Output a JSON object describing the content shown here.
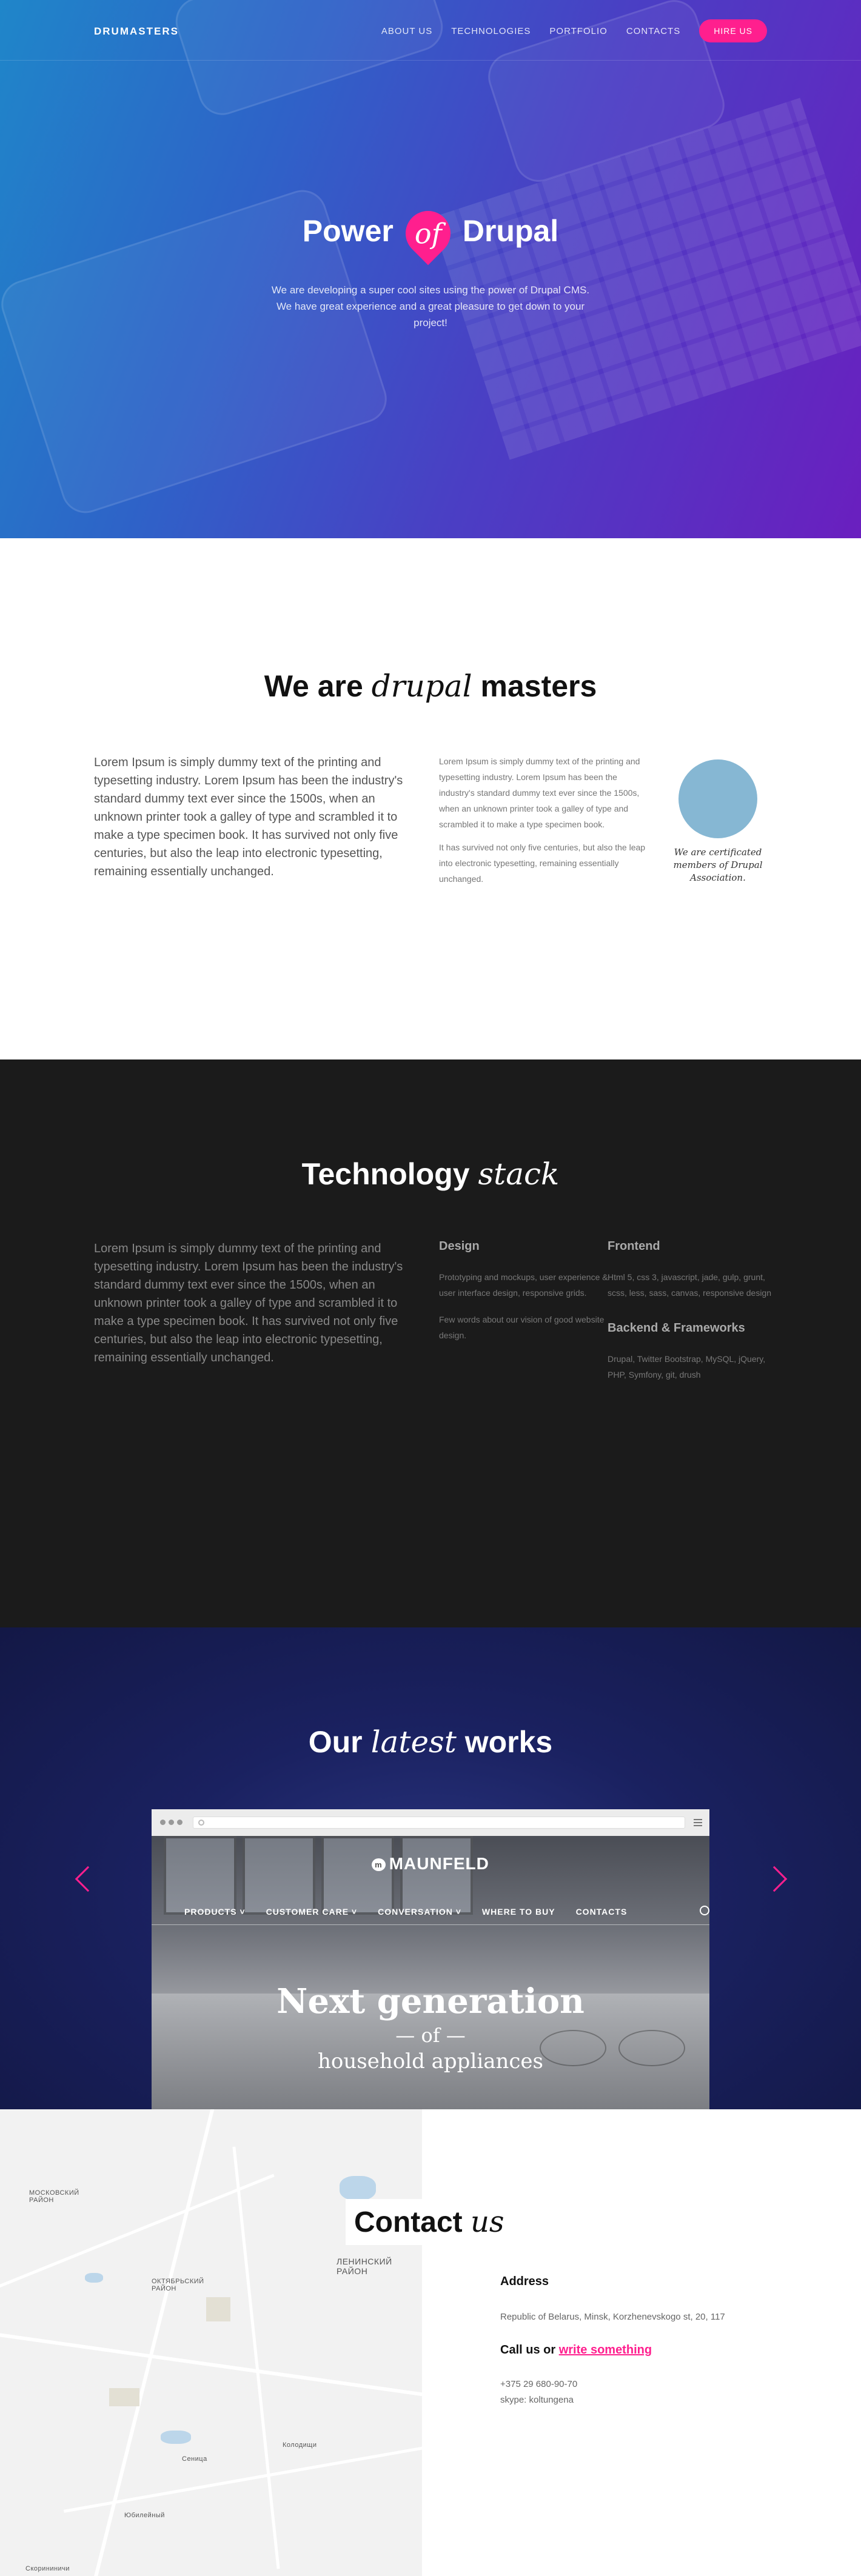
{
  "nav": {
    "brand": "DRUMASTERS",
    "links": [
      "ABOUT US",
      "TECHNOLOGIES",
      "PORTFOLIO",
      "CONTACTS"
    ],
    "hire": "HIRE US"
  },
  "hero": {
    "title_before": "Power",
    "title_of": "of",
    "title_after": "Drupal",
    "subtitle": "We are developing a super cool sites using the power of Drupal CMS. We have great experience and a great pleasure to get down to your project!"
  },
  "about": {
    "title_before": "We are",
    "title_italic": "drupal",
    "title_after": "masters",
    "lead": "Lorem Ipsum is simply dummy text of the printing and typesetting industry. Lorem Ipsum has been the industry's standard dummy text ever since the 1500s, when an unknown printer took a galley of type and scrambled it to make a type specimen book. It has survived not only five centuries, but also the leap into electronic typesetting, remaining essentially unchanged.",
    "p1": "Lorem Ipsum is simply dummy text of the printing and typesetting industry. Lorem Ipsum has been the industry's standard dummy text ever since the 1500s, when an unknown printer took a galley of type and scrambled it to make a type specimen book.",
    "p2": "It has survived not only five centuries, but also the leap into electronic typesetting, remaining essentially unchanged.",
    "cert": "We are certificated members of Drupal Association."
  },
  "tech": {
    "title_before": "Technology",
    "title_italic": "stack",
    "lead": "Lorem Ipsum is simply dummy text of the printing and typesetting industry. Lorem Ipsum has been the industry's standard dummy text ever since the 1500s, when an unknown printer took a galley of type and scrambled it to make a type specimen book. It has survived not only five centuries, but also the leap into electronic typesetting, remaining essentially unchanged.",
    "design_title": "Design",
    "design_p1": "Prototyping and mockups, user experience & user interface design, responsive grids.",
    "design_p2": "Few words about our vision of good website design.",
    "frontend_title": "Frontend",
    "frontend_p": "Html 5, css 3, javascript, jade, gulp, grunt, scss, less, sass, canvas, responsive design",
    "backend_title": "Backend & Frameworks",
    "backend_p": "Drupal, Twitter Bootstrap, MySQL, jQuery, PHP, Symfony, git, drush"
  },
  "works": {
    "title_before": "Our",
    "title_italic": "latest",
    "title_after": "works",
    "site_logo": "MAUNFELD",
    "site_logo_mark": "m",
    "site_nav": [
      "PRODUCTS ˅",
      "CUSTOMER CARE ˅",
      "CONVERSATION ˅",
      "WHERE TO BUY",
      "CONTACTS"
    ],
    "headline": "Next generation",
    "headline_of": "— of —",
    "headline_sub": "household appliances"
  },
  "contact": {
    "title_before": "Contact",
    "title_italic": "us",
    "address_title": "Address",
    "address": "Republic of Belarus, Minsk, Korzhenevskogo st, 20, 117",
    "call_before": "Call us or",
    "call_link": "write something",
    "phone": "+375 29 680-90-70",
    "skype": "skype: koltungena",
    "map_labels": [
      "МОСКОВСКИЙ РАЙОН",
      "ОКТЯБРЬСКИЙ РАЙОН",
      "ЛЕНИНСКИЙ РАЙОН",
      "Колодищи",
      "Сеница",
      "Юбилейный",
      "Скорининичи"
    ]
  }
}
